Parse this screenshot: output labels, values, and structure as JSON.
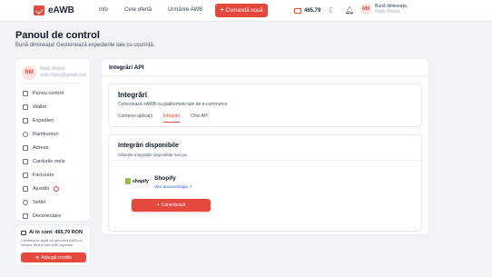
{
  "header": {
    "logo_text": "eAWB",
    "nav": [
      "Info",
      "Cere ofertă",
      "Urmărire AWB"
    ],
    "order_button": "Comandă nouă",
    "wallet_amount": "465,79",
    "user_greeting": "Bună dimineața,",
    "user_name": "Radu Ristea",
    "user_initials": "RM"
  },
  "page": {
    "title": "Panoul de control",
    "subtitle": "Bună dimineața! Gestionează expedierile tale cu ușurință."
  },
  "sidebar": {
    "user_initials": "RM",
    "user_name": "Radu Ristea",
    "user_email": "radu.ristea@gmail.com",
    "items": [
      {
        "label": "Panou control",
        "icon": "dashboard-icon"
      },
      {
        "label": "Wallet",
        "icon": "wallet-icon"
      },
      {
        "label": "Expedieri",
        "icon": "package-icon"
      },
      {
        "label": "Rambursuri",
        "icon": "refund-icon"
      },
      {
        "label": "Adrese",
        "icon": "address-icon"
      },
      {
        "label": "Cardurile mele",
        "icon": "card-icon"
      },
      {
        "label": "Facturare",
        "icon": "invoice-icon"
      },
      {
        "label": "Ajustări",
        "icon": "adjust-icon",
        "badge": "!"
      },
      {
        "label": "Setări",
        "icon": "gear-icon"
      },
      {
        "label": "Deconectare",
        "icon": "logout-icon"
      }
    ]
  },
  "credit": {
    "title": "Ai în cont: 465,79 RON",
    "description": "Creditele te ajută să generezi AWB-uri instant, fără a face plăți repetate.",
    "button": "Adaugă credite"
  },
  "main": {
    "title": "Integrări API",
    "integrations": {
      "title": "Integrări",
      "description": "Conectează eAWB cu platformele tale de e-commerce",
      "tabs": [
        "Comenzi aplicații",
        "Integrări",
        "Chei API"
      ],
      "active_tab": 1
    },
    "available": {
      "title": "Integrări disponibile",
      "description": "Găsește integrările disponibile mai jos",
      "shop_logo_text": "shopify",
      "shop_name": "Shopify",
      "doc_link": "Vezi documentația",
      "connect_button": "Conectează"
    }
  },
  "colors": {
    "accent": "#e5483d",
    "link": "#2563eb",
    "background": "#f2f3f5"
  }
}
